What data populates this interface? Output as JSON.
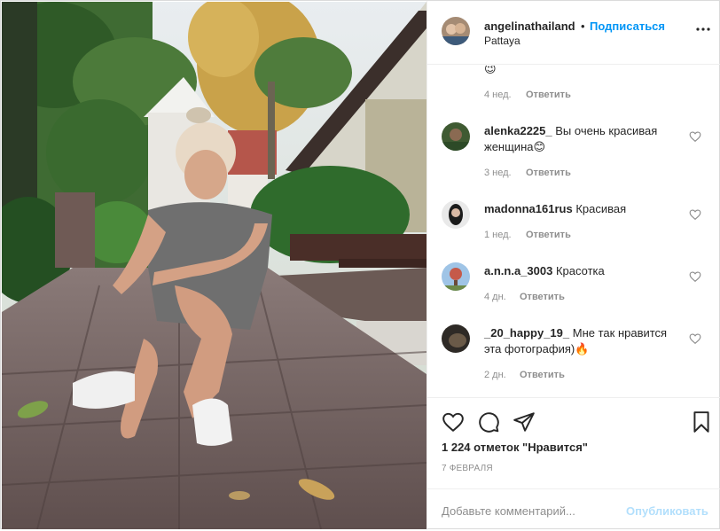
{
  "header": {
    "username": "angelinathailand",
    "separator": "•",
    "follow_label": "Подписаться",
    "location": "Pattaya"
  },
  "comments": [
    {
      "user": "",
      "text": "",
      "emoji": "😉",
      "time": "4 нед.",
      "reply": "Ответить"
    },
    {
      "user": "alenka2225_",
      "text": "Вы очень красивая",
      "text2": "женщина😊",
      "time": "3 нед.",
      "reply": "Ответить"
    },
    {
      "user": "madonna161rus",
      "text": "Красивая",
      "time": "1 нед.",
      "reply": "Ответить"
    },
    {
      "user": "a.n.n.a_3003",
      "text": "Красотка",
      "time": "4 дн.",
      "reply": "Ответить"
    },
    {
      "user": "_20_happy_19_",
      "text": "Мне так нравится",
      "text2": "эта фотография)🔥",
      "time": "2 дн.",
      "reply": "Ответить"
    }
  ],
  "actions": {
    "likes": "1 224 отметок \"Нравится\"",
    "date": "7 ФЕВРАЛЯ"
  },
  "add_comment": {
    "placeholder": "Добавьте комментарий...",
    "publish_label": "Опубликовать"
  },
  "icons": {
    "like": "heart-icon",
    "comment": "comment-icon",
    "share": "share-icon",
    "save": "bookmark-icon",
    "more": "more-icon"
  },
  "colors": {
    "link": "#0095f6",
    "publish_disabled": "#b2dffc",
    "muted": "#8e8e8e"
  }
}
